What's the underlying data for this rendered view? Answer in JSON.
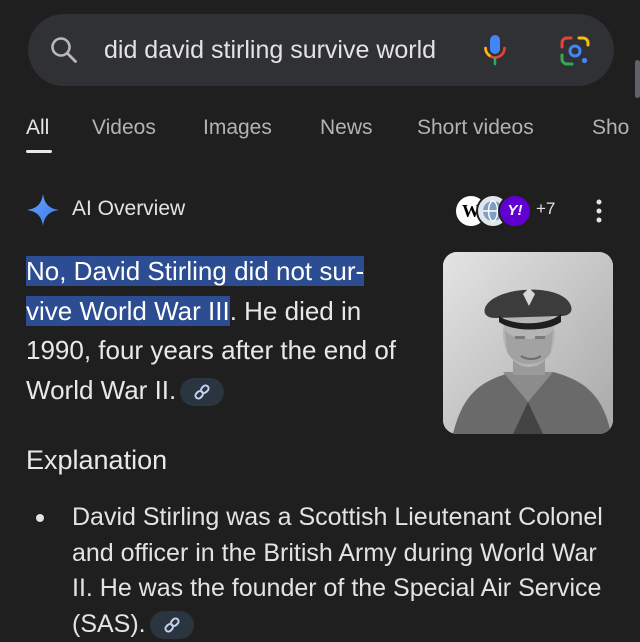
{
  "search": {
    "query": "did david stirling survive world",
    "icon": "search-icon",
    "mic_icon": "mic-icon",
    "lens_icon": "google-lens-icon"
  },
  "tabs": [
    {
      "label": "All",
      "active": true
    },
    {
      "label": "Videos"
    },
    {
      "label": "Images"
    },
    {
      "label": "News"
    },
    {
      "label": "Short videos"
    },
    {
      "label": "Sho"
    }
  ],
  "ai_overview": {
    "label": "AI Overview",
    "sources": [
      "W",
      "globe",
      "Y!"
    ],
    "source_count": "+7",
    "answer_highlight_1": "No, David Stirling did not sur-",
    "answer_highlight_2": "vive World War III",
    "answer_rest": ". He died in 1990, four years after the end of World War II.",
    "image_description": "Black-and-white portrait photo"
  },
  "explanation": {
    "title": "Explanation",
    "bullets": [
      "David Stirling was a Scottish Lieutenant Colonel and officer in the British Army during World War II. He was the founder of the Special Air Service (SAS)."
    ]
  },
  "colors": {
    "background": "#1f1f1f",
    "search_bar": "#303134",
    "highlight": "#2c4d91",
    "ai_star": "#4c8df6"
  }
}
